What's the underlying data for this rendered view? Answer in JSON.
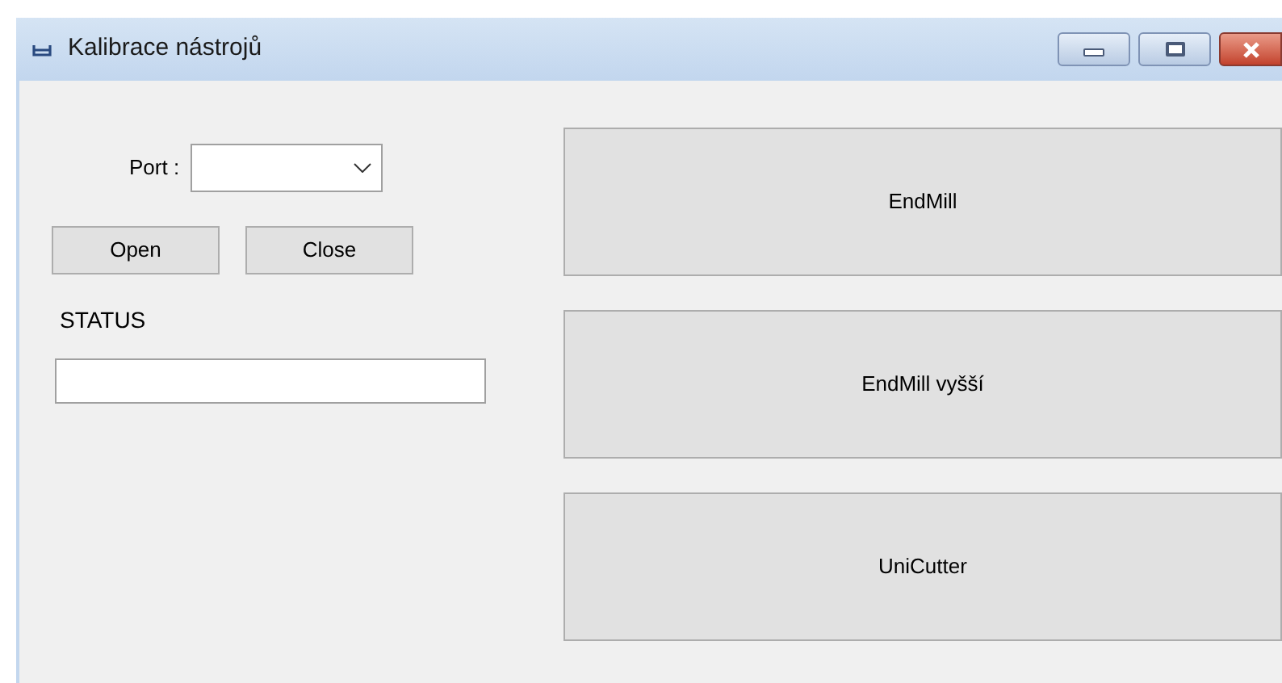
{
  "window": {
    "title": "Kalibrace nástrojů"
  },
  "port": {
    "label": "Port :"
  },
  "connection_buttons": [
    "Open",
    "Close"
  ],
  "status": {
    "label": "STATUS"
  },
  "tool_buttons": [
    "EndMill",
    "EndMill vyšší",
    "UniCutter"
  ]
}
